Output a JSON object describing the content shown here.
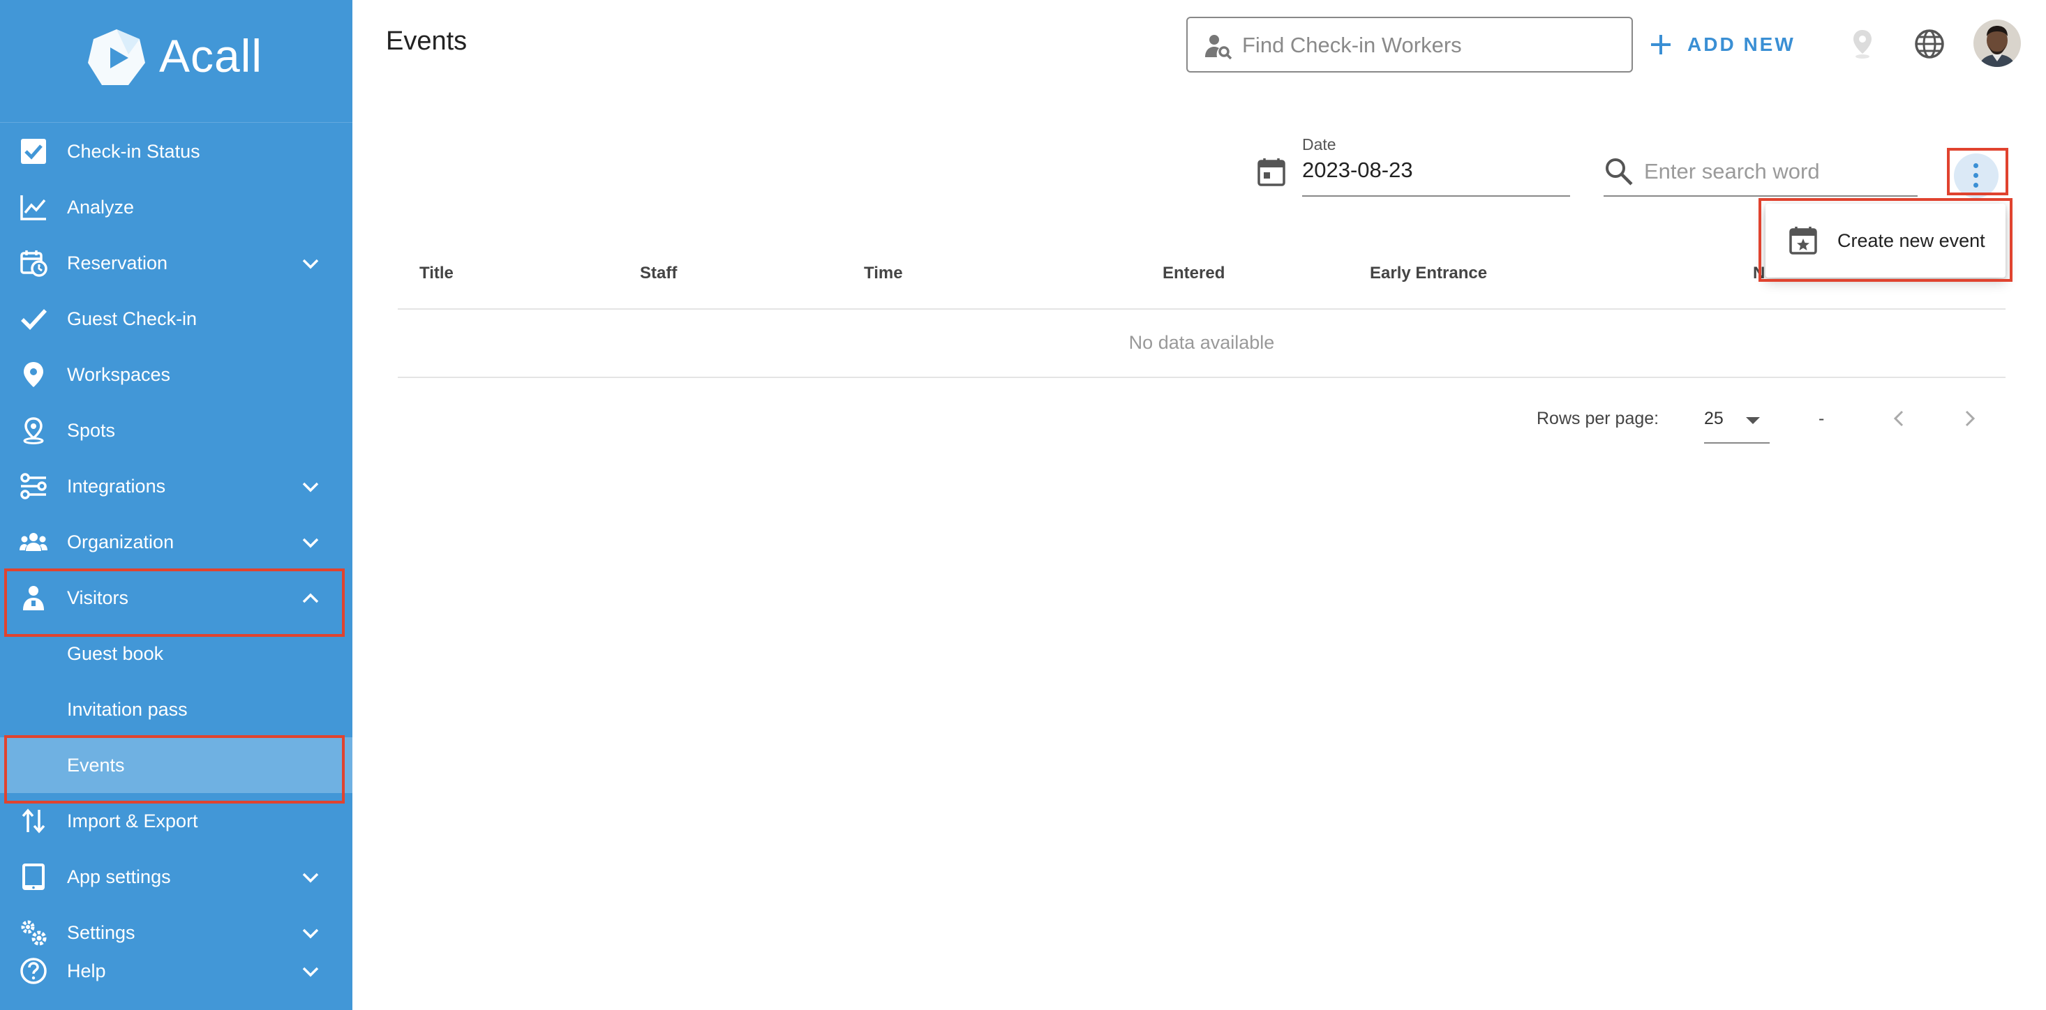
{
  "app": {
    "logo_text": "Acall"
  },
  "sidebar": {
    "items": [
      {
        "label": "Check-in Status",
        "icon": "checkbox-icon"
      },
      {
        "label": "Analyze",
        "icon": "line-chart-icon"
      },
      {
        "label": "Reservation",
        "icon": "calendar-clock-icon",
        "expandable": true
      },
      {
        "label": "Guest Check-in",
        "icon": "check-icon"
      },
      {
        "label": "Workspaces",
        "icon": "location-pin-icon"
      },
      {
        "label": "Spots",
        "icon": "spot-pin-icon"
      },
      {
        "label": "Integrations",
        "icon": "integrations-icon",
        "expandable": true
      },
      {
        "label": "Organization",
        "icon": "people-icon",
        "expandable": true
      },
      {
        "label": "Visitors",
        "icon": "visitor-icon",
        "expandable": true,
        "expanded": true
      },
      {
        "label": "Guest book",
        "sub": true
      },
      {
        "label": "Invitation pass",
        "sub": true
      },
      {
        "label": "Events",
        "sub": true,
        "active": true
      },
      {
        "label": "Import & Export",
        "icon": "import-export-icon"
      },
      {
        "label": "App settings",
        "icon": "tablet-icon",
        "expandable": true
      },
      {
        "label": "Settings",
        "icon": "gears-icon",
        "expandable": true
      },
      {
        "label": "Help",
        "icon": "help-icon",
        "expandable": true
      }
    ]
  },
  "header": {
    "title": "Events",
    "find_placeholder": "Find Check-in Workers",
    "add_new_label": "ADD NEW"
  },
  "filters": {
    "date_label": "Date",
    "date_value": "2023-08-23",
    "search_placeholder": "Enter search word"
  },
  "menu": {
    "create_event_label": "Create new event"
  },
  "table": {
    "columns": [
      "Title",
      "Staff",
      "Time",
      "Entered",
      "Early Entrance",
      "N"
    ],
    "empty_text": "No data available"
  },
  "pagination": {
    "rows_per_page_label": "Rows per page:",
    "rows_per_page_value": "25",
    "range_text": "-"
  },
  "colors": {
    "sidebar": "#4297d7",
    "accent": "#3a8fd4",
    "highlight": "#e0432f"
  }
}
